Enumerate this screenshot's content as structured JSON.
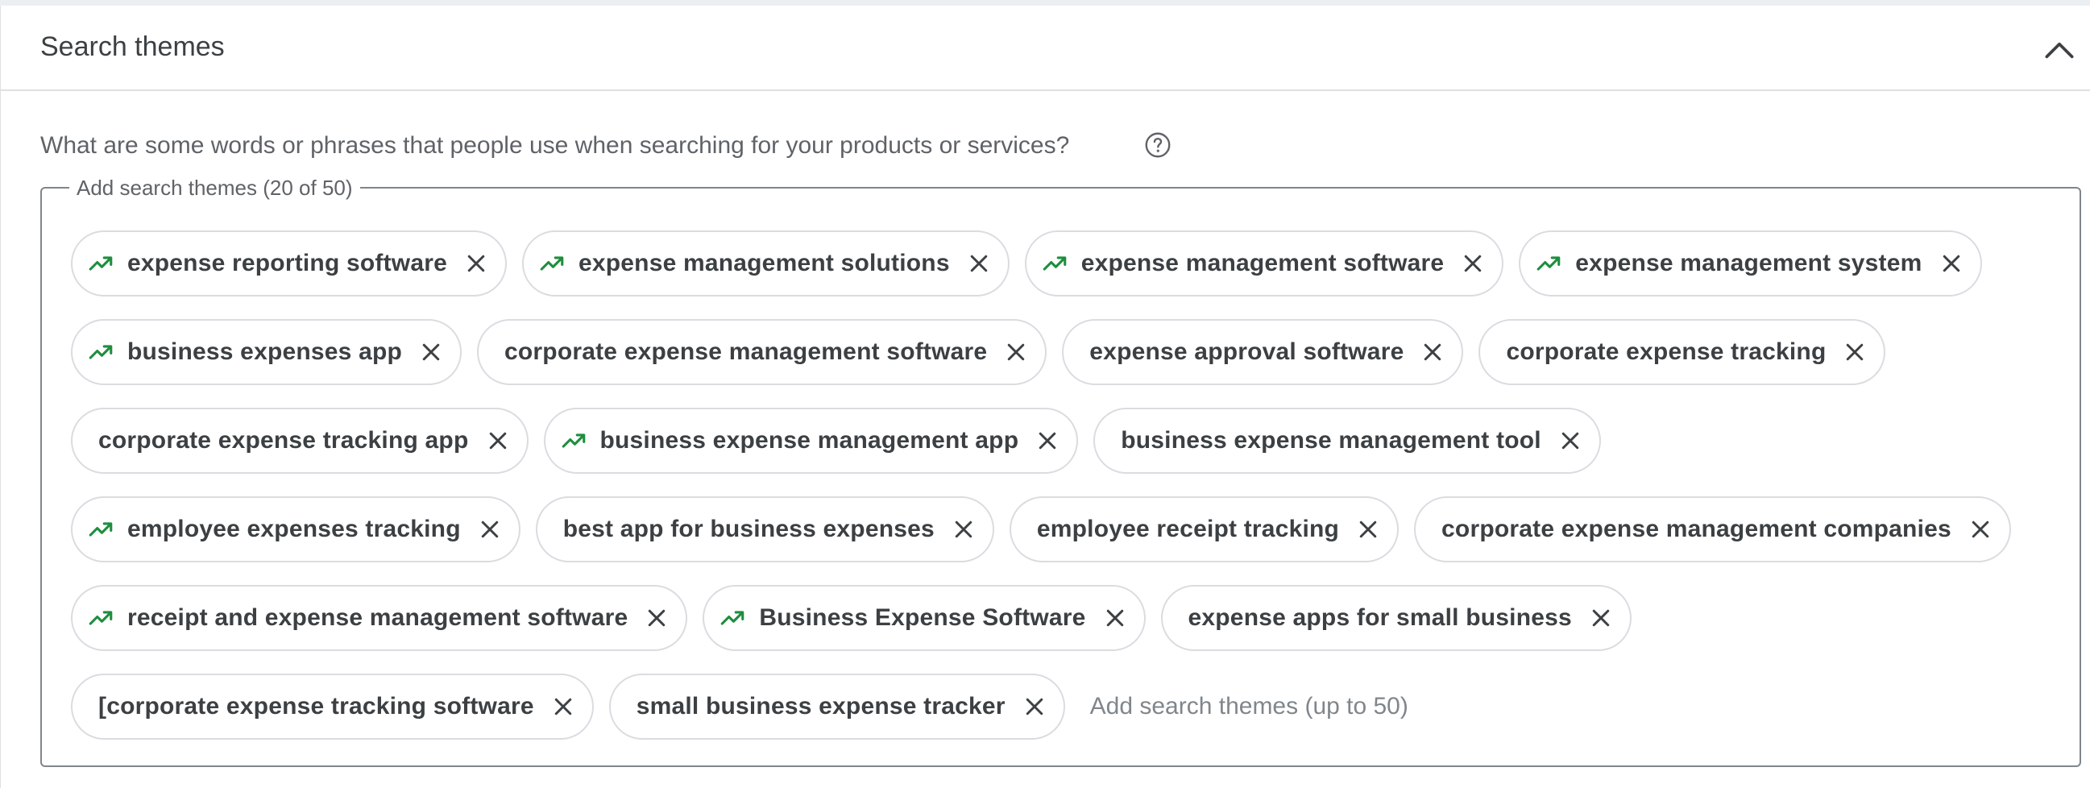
{
  "section": {
    "title": "Search themes",
    "collapse_icon": "chevron-up-icon"
  },
  "question": {
    "text": "What are some words or phrases that people use when searching for your products or services?",
    "help_icon": "help-circle-icon"
  },
  "themes_field": {
    "legend": "Add search themes (20 of 50)",
    "placeholder": "Add search themes (up to 50)",
    "value": ""
  },
  "colors": {
    "trend_green": "#1e8e3e",
    "chip_border": "#dadce0",
    "field_border": "#80868b",
    "text": "#3c4043",
    "muted_text": "#5f6368"
  },
  "chips": [
    {
      "label": "expense reporting software",
      "trending": true
    },
    {
      "label": "expense management solutions",
      "trending": true
    },
    {
      "label": "expense management software",
      "trending": true
    },
    {
      "label": "expense management system",
      "trending": true
    },
    {
      "label": "business expenses app",
      "trending": true
    },
    {
      "label": "corporate expense management software",
      "trending": false
    },
    {
      "label": "expense approval software",
      "trending": false
    },
    {
      "label": "corporate expense tracking",
      "trending": false
    },
    {
      "label": "corporate expense tracking app",
      "trending": false
    },
    {
      "label": "business expense management app",
      "trending": true
    },
    {
      "label": "business expense management tool",
      "trending": false
    },
    {
      "label": "employee expenses tracking",
      "trending": true
    },
    {
      "label": "best app for business expenses",
      "trending": false
    },
    {
      "label": "employee receipt tracking",
      "trending": false
    },
    {
      "label": "corporate expense management companies",
      "trending": false
    },
    {
      "label": "receipt and expense management software",
      "trending": true
    },
    {
      "label": "Business Expense Software",
      "trending": true
    },
    {
      "label": "expense apps for small business",
      "trending": false
    },
    {
      "label": "[corporate expense tracking software",
      "trending": false
    },
    {
      "label": "small business expense tracker",
      "trending": false
    }
  ]
}
